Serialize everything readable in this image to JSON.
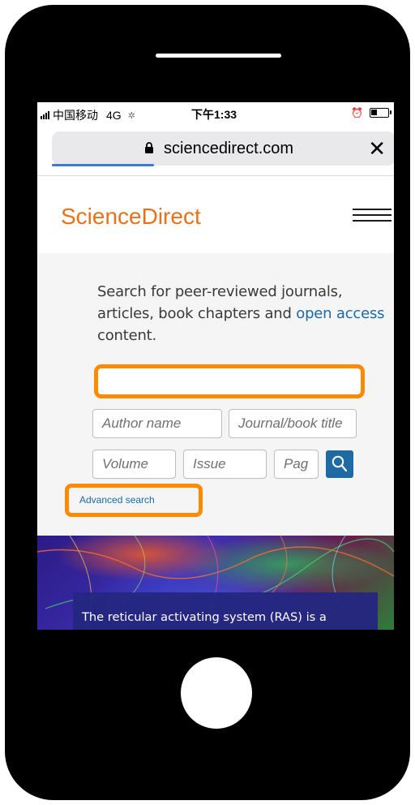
{
  "status_bar": {
    "carrier": "中国移动",
    "network": "4G",
    "time": "下午1:33"
  },
  "browser": {
    "url": "sciencedirect.com",
    "close_icon": "close-icon",
    "lock_icon": "lock-icon"
  },
  "header": {
    "logo": "ScienceDirect",
    "menu_icon": "hamburger-menu-icon"
  },
  "search": {
    "intro_text": "Search for peer-reviewed journals, articles, book chapters and ",
    "intro_link": "open access",
    "intro_end": "content.",
    "keywords_value": "",
    "author_placeholder": "Author name",
    "journal_placeholder": "Journal/book title",
    "volume_placeholder": "Volume",
    "issue_placeholder": "Issue",
    "pages_placeholder": "Pag",
    "search_icon": "search-icon",
    "advanced_label": "Advanced search"
  },
  "hero": {
    "caption": "The reticular activating system (RAS) is a network of neurons located in the brain stem that project anteriorly to the hypothalamus to mediate behavior, as well as both"
  },
  "colors": {
    "brand": "#e9711c",
    "link": "#1a6aa5",
    "search_button": "#1f6aa3",
    "highlight": "#ff8a00",
    "caption_bg": "#242680"
  }
}
